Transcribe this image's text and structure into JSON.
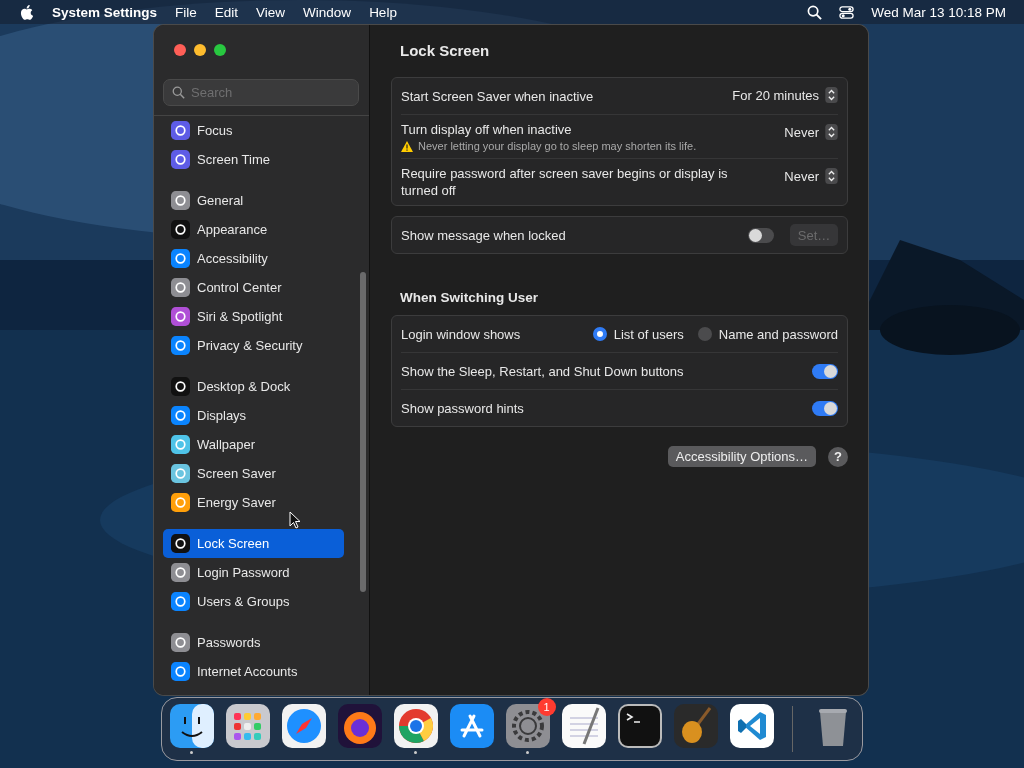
{
  "menu_bar": {
    "app_name": "System Settings",
    "menus": [
      "File",
      "Edit",
      "View",
      "Window",
      "Help"
    ],
    "clock": "Wed Mar 13  10:18 PM"
  },
  "sidebar": {
    "search": {
      "placeholder": "Search"
    },
    "groups": [
      [
        {
          "label": "Focus",
          "color": "#5e5ce6",
          "selected": false
        },
        {
          "label": "Screen Time",
          "color": "#5e5ce6",
          "selected": false
        }
      ],
      [
        {
          "label": "General",
          "color": "#8e8e93",
          "selected": false
        },
        {
          "label": "Appearance",
          "color": "#111111",
          "selected": false
        },
        {
          "label": "Accessibility",
          "color": "#0a84ff",
          "selected": false
        },
        {
          "label": "Control Center",
          "color": "#8e8e93",
          "selected": false
        },
        {
          "label": "Siri & Spotlight",
          "color": "#b04fd6",
          "selected": false
        },
        {
          "label": "Privacy & Security",
          "color": "#0a84ff",
          "selected": false
        }
      ],
      [
        {
          "label": "Desktop & Dock",
          "color": "#111111",
          "selected": false
        },
        {
          "label": "Displays",
          "color": "#0a84ff",
          "selected": false
        },
        {
          "label": "Wallpaper",
          "color": "#4fc3e8",
          "selected": false
        },
        {
          "label": "Screen Saver",
          "color": "#6ac4e0",
          "selected": false
        },
        {
          "label": "Energy Saver",
          "color": "#ff9f0a",
          "selected": false
        }
      ],
      [
        {
          "label": "Lock Screen",
          "color": "#111111",
          "selected": true
        },
        {
          "label": "Login Password",
          "color": "#8e8e93",
          "selected": false
        },
        {
          "label": "Users & Groups",
          "color": "#0a84ff",
          "selected": false
        }
      ],
      [
        {
          "label": "Passwords",
          "color": "#8e8e93",
          "selected": false
        },
        {
          "label": "Internet Accounts",
          "color": "#0a84ff",
          "selected": false
        }
      ]
    ]
  },
  "content": {
    "title": "Lock Screen",
    "sections": [
      {
        "rows": [
          {
            "kind": "popup",
            "label": "Start Screen Saver when inactive",
            "value": "For 20 minutes"
          },
          {
            "kind": "popup",
            "label": "Turn display off when inactive",
            "value": "Never",
            "warning": "Never letting your display go to sleep may shorten its life."
          },
          {
            "kind": "popup",
            "label": "Require password after screen saver begins or display is turned off",
            "value": "Never"
          }
        ]
      },
      {
        "rows": [
          {
            "kind": "toggle",
            "label": "Show message when locked",
            "on": false,
            "button": {
              "label": "Set…",
              "disabled": true
            }
          }
        ]
      },
      {
        "heading": "When Switching User",
        "rows": [
          {
            "kind": "radio",
            "label": "Login window shows",
            "options": [
              {
                "label": "List of users",
                "selected": true
              },
              {
                "label": "Name and password",
                "selected": false
              }
            ]
          },
          {
            "kind": "toggle",
            "label": "Show the Sleep, Restart, and Shut Down buttons",
            "on": true
          },
          {
            "kind": "toggle",
            "label": "Show password hints",
            "on": true
          }
        ]
      }
    ],
    "footer": {
      "button": "Accessibility Options…",
      "help": "?"
    }
  },
  "dock": [
    {
      "kind": "finder",
      "running": true
    },
    {
      "kind": "launchpad",
      "running": false
    },
    {
      "kind": "compass",
      "running": false
    },
    {
      "kind": "fox",
      "running": false
    },
    {
      "kind": "chrome",
      "running": true
    },
    {
      "kind": "store",
      "running": false
    },
    {
      "kind": "gear",
      "running": true,
      "badge": "1"
    },
    {
      "kind": "notes",
      "running": false
    },
    {
      "kind": "terminal",
      "running": false
    },
    {
      "kind": "guitar",
      "running": false
    },
    {
      "kind": "code",
      "running": false
    },
    {
      "kind": "separator"
    },
    {
      "kind": "trash",
      "running": false
    }
  ]
}
